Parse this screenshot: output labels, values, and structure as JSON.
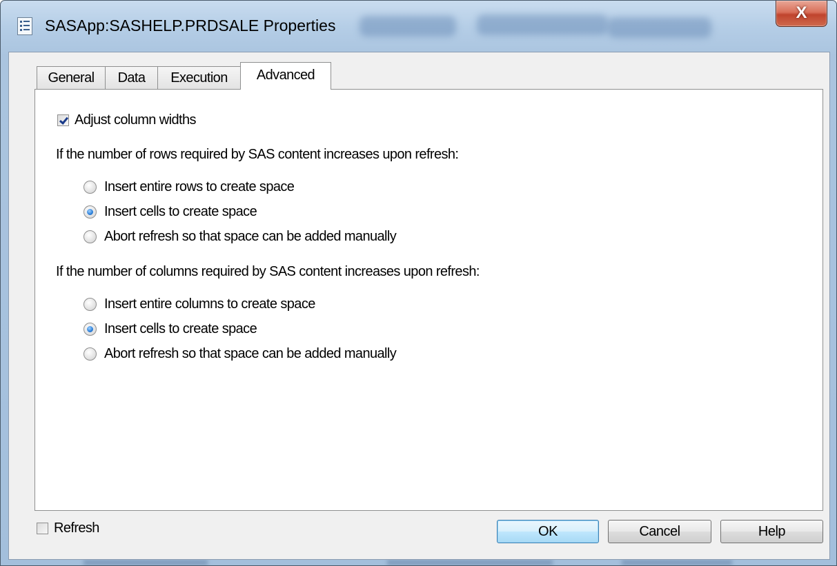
{
  "window": {
    "title": "SASApp:SASHELP.PRDSALE Properties",
    "close_glyph": "X"
  },
  "tabs": [
    {
      "label": "General",
      "active": false
    },
    {
      "label": "Data",
      "active": false
    },
    {
      "label": "Execution",
      "active": false
    },
    {
      "label": "Advanced",
      "active": true
    }
  ],
  "advanced": {
    "adjust_column_widths": {
      "label": "Adjust column widths",
      "checked": true
    },
    "rows_heading": "If the number of rows required by SAS content increases upon refresh:",
    "rows_options": [
      {
        "label": "Insert entire rows to create space",
        "selected": false
      },
      {
        "label": "Insert cells to create space",
        "selected": true
      },
      {
        "label": "Abort refresh so that space can be added manually",
        "selected": false
      }
    ],
    "columns_heading": "If the number of columns required by SAS content increases upon refresh:",
    "columns_options": [
      {
        "label": "Insert entire columns to create space",
        "selected": false
      },
      {
        "label": "Insert cells to create space",
        "selected": true
      },
      {
        "label": "Abort refresh so that space can be added manually",
        "selected": false
      }
    ]
  },
  "footer": {
    "refresh": {
      "label": "Refresh",
      "checked": false
    },
    "ok_label": "OK",
    "cancel_label": "Cancel",
    "help_label": "Help"
  },
  "colors": {
    "accent": "#2c7fd8",
    "close_button": "#c0442d",
    "default_button_border": "#3c7fb1"
  },
  "icons": {
    "app_icon": "properties-list-icon",
    "close_icon": "close-icon"
  }
}
